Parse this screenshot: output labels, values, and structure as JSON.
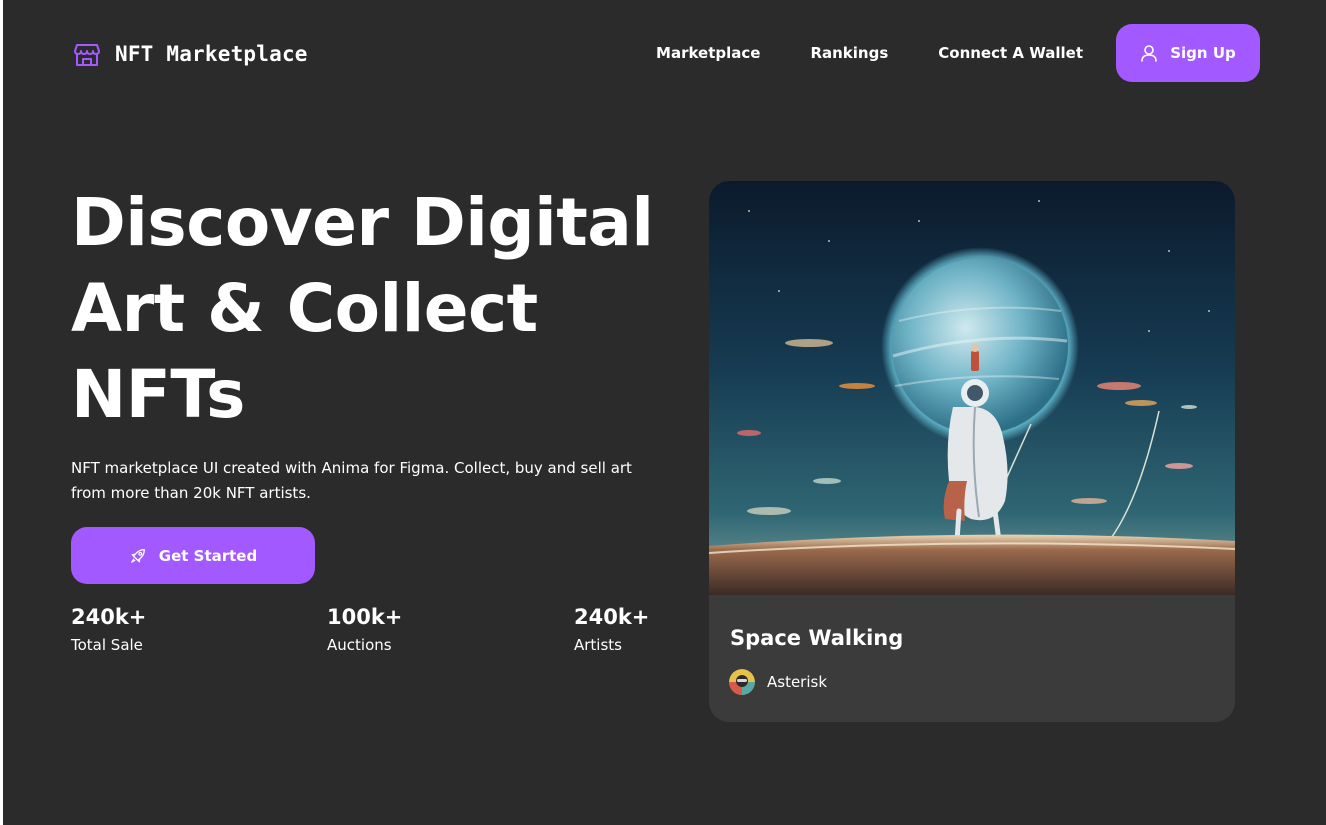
{
  "header": {
    "logo_text": "NFT Marketplace",
    "nav": [
      "Marketplace",
      "Rankings",
      "Connect A Wallet"
    ],
    "signup_label": "Sign Up"
  },
  "hero": {
    "title": "Discover Digital Art & Collect NFTs",
    "description": "NFT marketplace UI created with Anima for Figma. Collect, buy and sell art from more than 20k NFT artists.",
    "cta_label": "Get Started",
    "stats": [
      {
        "value": "240k+",
        "label": "Total Sale"
      },
      {
        "value": "100k+",
        "label": "Auctions"
      },
      {
        "value": "240k+",
        "label": "Artists"
      }
    ]
  },
  "featured": {
    "title": "Space Walking",
    "artist": "Asterisk"
  },
  "icons": {
    "logo": "storefront-icon",
    "signup": "user-icon",
    "cta": "rocket-icon"
  },
  "colors": {
    "background": "#2b2b2b",
    "accent": "#a259ff",
    "card": "#3b3b3b",
    "text": "#ffffff"
  }
}
